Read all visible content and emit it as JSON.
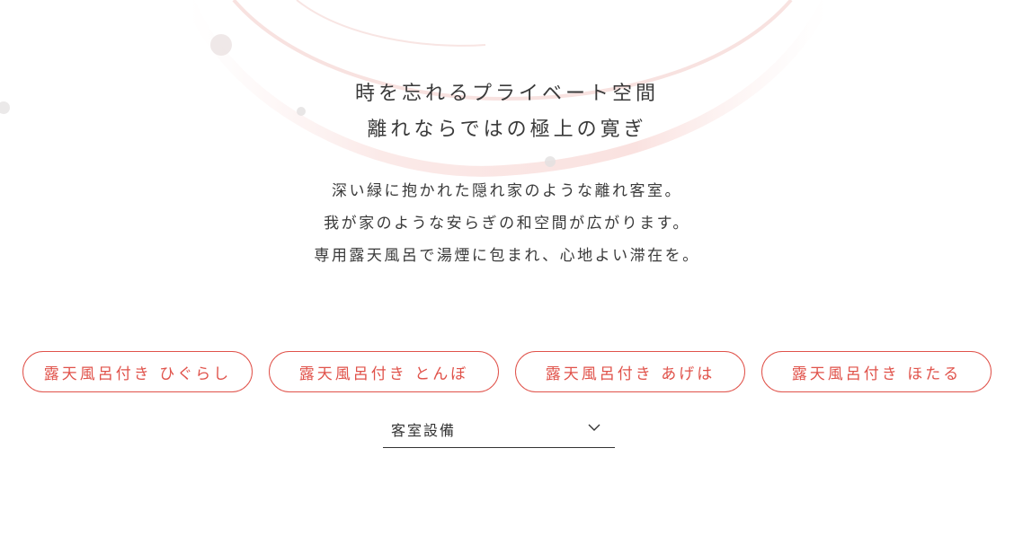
{
  "heading": {
    "line1": "時を忘れるプライベート空間",
    "line2": "離れならではの極上の寛ぎ"
  },
  "description": {
    "line1": "深い緑に抱かれた隠れ家のような離れ客室。",
    "line2": "我が家のような安らぎの和空間が広がります。",
    "line3": "専用露天風呂で湯煙に包まれ、心地よい滞在を。"
  },
  "rooms": [
    {
      "label": "露天風呂付き ひぐらし"
    },
    {
      "label": "露天風呂付き とんぼ"
    },
    {
      "label": "露天風呂付き あげは"
    },
    {
      "label": "露天風呂付き ほたる"
    }
  ],
  "amenities_dropdown": {
    "label": "客室設備",
    "icon": "chevron-down-icon"
  },
  "colors": {
    "accent": "#e0524a",
    "text": "#333333",
    "decor": "#f3c9c6"
  }
}
